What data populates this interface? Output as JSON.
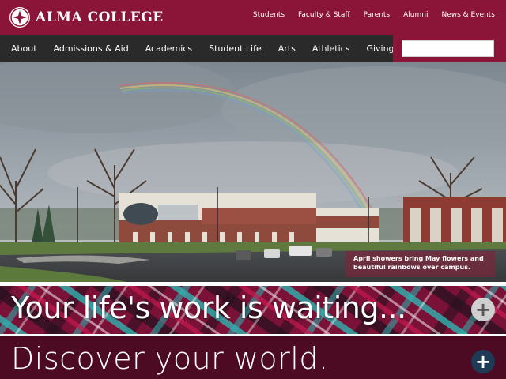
{
  "brand": {
    "name": "ALMA COLLEGE"
  },
  "utility_nav": [
    "Students",
    "Faculty & Staff",
    "Parents",
    "Alumni",
    "News & Events"
  ],
  "main_nav": [
    "About",
    "Admissions & Aid",
    "Academics",
    "Student Life",
    "Arts",
    "Athletics",
    "Giving"
  ],
  "search": {
    "placeholder": ""
  },
  "hero": {
    "caption": "April showers bring May flowers and beautiful rainbows over campus."
  },
  "banners": {
    "primary": {
      "text": "Your life's work is waiting...",
      "button": "+"
    },
    "secondary": {
      "text": "Discover your world.",
      "button": "+"
    }
  },
  "colors": {
    "brand": "#8a1538",
    "nav": "#2a2a2a",
    "dark_band": "#4d0a23",
    "teal": "#2fb3b0"
  }
}
